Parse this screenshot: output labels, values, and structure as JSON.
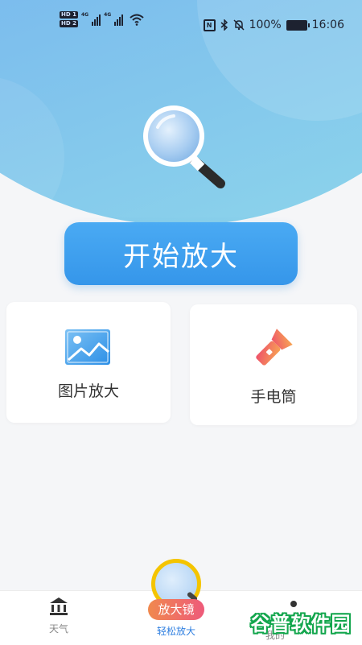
{
  "status_bar": {
    "hd1": "HD 1",
    "hd2": "HD 2",
    "net1": "4G",
    "net2": "4G",
    "nfc": "N",
    "battery": "100%",
    "time": "16:06"
  },
  "main": {
    "start_button_label": "开始放大"
  },
  "cards": [
    {
      "label": "图片放大",
      "icon": "image-icon"
    },
    {
      "label": "手电筒",
      "icon": "flashlight-icon"
    }
  ],
  "bottom_nav": {
    "weather_label": "天气",
    "center_badge": "放大镜",
    "center_label": "轻松放大",
    "right_label": "我的"
  },
  "watermark": "谷普软件园",
  "colors": {
    "accent_blue": "#3596ea",
    "hero_gradient_start": "#6aa0ee",
    "hero_gradient_end": "#8fd8ea",
    "badge_gradient_start": "#f0894e",
    "badge_gradient_end": "#ee5a7a",
    "watermark_green": "#13a64d"
  }
}
